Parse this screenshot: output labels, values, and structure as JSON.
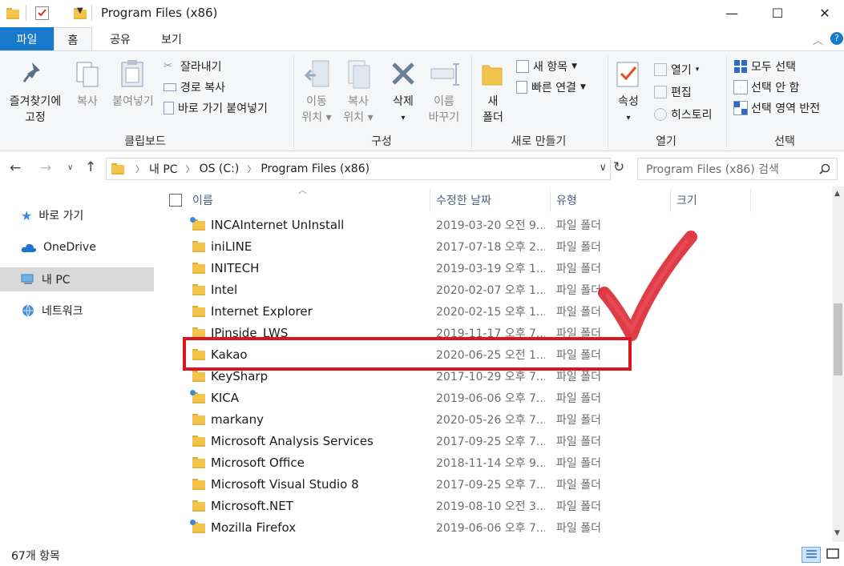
{
  "window": {
    "title": "Program Files (x86)",
    "minimize_glyph": "—",
    "maximize_glyph": "☐",
    "close_glyph": "✕"
  },
  "ribbon_tabs": [
    {
      "label": "파일"
    },
    {
      "label": "홈"
    },
    {
      "label": "공유"
    },
    {
      "label": "보기"
    }
  ],
  "ribbon": {
    "clipboard": {
      "pin_label_1": "즐겨찾기에",
      "pin_label_2": "고정",
      "copy_label": "복사",
      "paste_label": "붙여넣기",
      "cut_label": "잘라내기",
      "copy_path_label": "경로 복사",
      "paste_shortcut_label": "바로 가기 붙여넣기",
      "group_label": "클립보드"
    },
    "organize": {
      "move_label_1": "이동",
      "move_label_2": "위치",
      "copyto_label_1": "복사",
      "copyto_label_2": "위치",
      "delete_label": "삭제",
      "rename_label_1": "이름",
      "rename_label_2": "바꾸기",
      "group_label": "구성"
    },
    "new": {
      "new_folder_label_1": "새",
      "new_folder_label_2": "폴더",
      "new_item_label": "새 항목",
      "easy_access_label": "빠른 연결",
      "group_label": "새로 만들기"
    },
    "open": {
      "properties_label": "속성",
      "open_label": "열기",
      "edit_label": "편집",
      "history_label": "히스토리",
      "group_label": "열기"
    },
    "select": {
      "select_all_label": "모두 선택",
      "select_none_label": "선택 안 함",
      "invert_label": "선택 영역 반전",
      "group_label": "선택"
    }
  },
  "address": {
    "breadcrumb": [
      "내 PC",
      "OS (C:)",
      "Program Files (x86)"
    ],
    "search_placeholder": "Program Files (x86) 검색"
  },
  "nav_pane": {
    "items": [
      {
        "label": "바로 가기"
      },
      {
        "label": "OneDrive"
      },
      {
        "label": "내 PC"
      },
      {
        "label": "네트워크"
      }
    ]
  },
  "columns": {
    "name": "이름",
    "modified": "수정한 날짜",
    "type": "유형",
    "size": "크기"
  },
  "files": [
    {
      "name": "INCAInternet UnInstall",
      "date": "2019-03-20 오전 9...",
      "type": "파일 폴더",
      "shared": true
    },
    {
      "name": "iniLINE",
      "date": "2017-07-18 오후 2...",
      "type": "파일 폴더",
      "shared": false
    },
    {
      "name": "INITECH",
      "date": "2019-03-19 오후 1...",
      "type": "파일 폴더",
      "shared": false
    },
    {
      "name": "Intel",
      "date": "2020-02-07 오후 1...",
      "type": "파일 폴더",
      "shared": false
    },
    {
      "name": "Internet Explorer",
      "date": "2020-02-15 오후 1...",
      "type": "파일 폴더",
      "shared": false
    },
    {
      "name": "IPinside_LWS",
      "date": "2019-11-17 오후 7...",
      "type": "파일 폴더",
      "shared": false
    },
    {
      "name": "Kakao",
      "date": "2020-06-25 오전 1...",
      "type": "파일 폴더",
      "shared": false
    },
    {
      "name": "KeySharp",
      "date": "2017-10-29 오후 7...",
      "type": "파일 폴더",
      "shared": false
    },
    {
      "name": "KICA",
      "date": "2019-06-06 오후 7...",
      "type": "파일 폴더",
      "shared": true
    },
    {
      "name": "markany",
      "date": "2020-05-26 오후 7...",
      "type": "파일 폴더",
      "shared": false
    },
    {
      "name": "Microsoft Analysis Services",
      "date": "2017-09-25 오후 7...",
      "type": "파일 폴더",
      "shared": false
    },
    {
      "name": "Microsoft Office",
      "date": "2018-11-14 오후 9...",
      "type": "파일 폴더",
      "shared": false
    },
    {
      "name": "Microsoft Visual Studio 8",
      "date": "2017-09-25 오후 7...",
      "type": "파일 폴더",
      "shared": false
    },
    {
      "name": "Microsoft.NET",
      "date": "2019-08-10 오전 3...",
      "type": "파일 폴더",
      "shared": false
    },
    {
      "name": "Mozilla Firefox",
      "date": "2019-06-06 오후 7...",
      "type": "파일 폴더",
      "shared": true
    }
  ],
  "status": {
    "item_count": "67개 항목"
  },
  "colors": {
    "file_tab": "#1979ca",
    "highlight_box": "#e0141e",
    "checkmark": "#e0141e",
    "folder": "#f3c44b"
  }
}
